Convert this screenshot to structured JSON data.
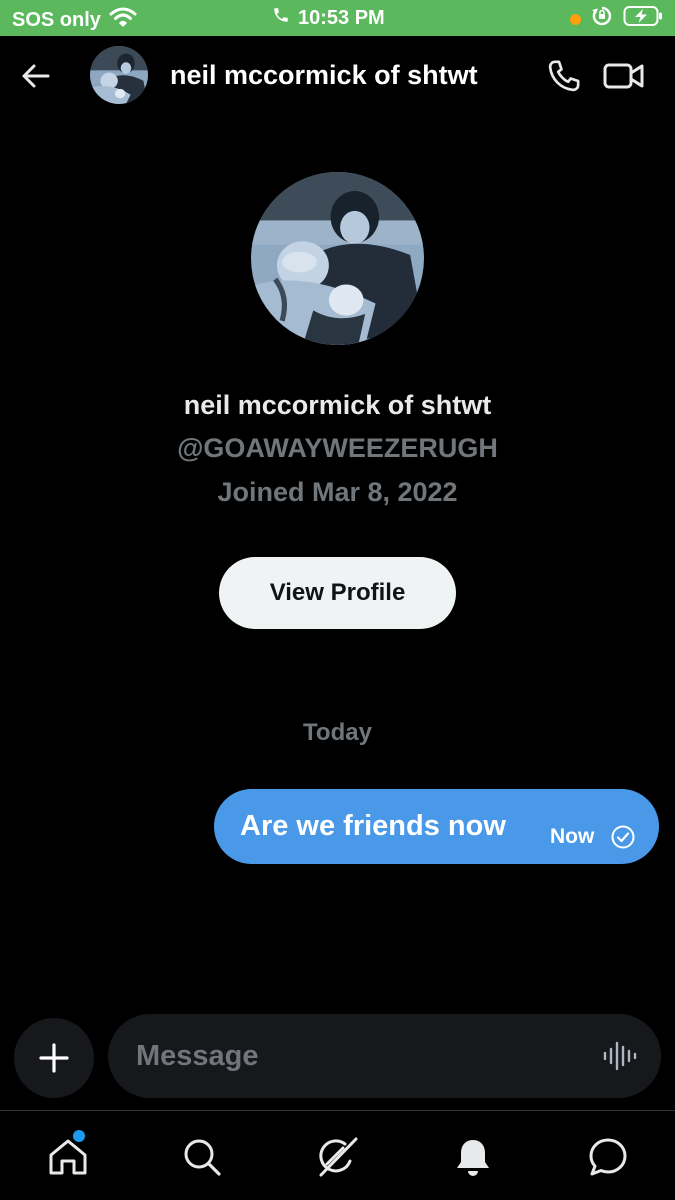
{
  "status_bar": {
    "carrier": "SOS only",
    "time": "10:53 PM",
    "colors": {
      "background": "#5cb85c",
      "recording_dot": "#ff9f0a"
    }
  },
  "header": {
    "name": "neil mccormick of shtwt",
    "icons": [
      "back-arrow-icon",
      "phone-icon",
      "video-camera-icon"
    ]
  },
  "profile": {
    "name": "neil mccormick of shtwt",
    "handle": "@GOAWAYWEEZERUGH",
    "joined": "Joined Mar 8, 2022",
    "view_profile_label": "View Profile"
  },
  "conversation": {
    "day_label": "Today",
    "messages": [
      {
        "text": "Are we friends now",
        "time": "Now",
        "status_icon": "read-check-icon",
        "outgoing": true
      }
    ],
    "colors": {
      "outgoing_bubble": "#4a99e9"
    }
  },
  "composer": {
    "placeholder": "Message",
    "icons": [
      "plus-icon",
      "voice-waveform-icon"
    ]
  },
  "tab_bar": {
    "tabs": [
      "home-icon",
      "search-icon",
      "grok-icon",
      "bell-icon",
      "messages-icon"
    ],
    "home_has_notification": true,
    "colors": {
      "notification_dot": "#1d9bf0"
    }
  }
}
